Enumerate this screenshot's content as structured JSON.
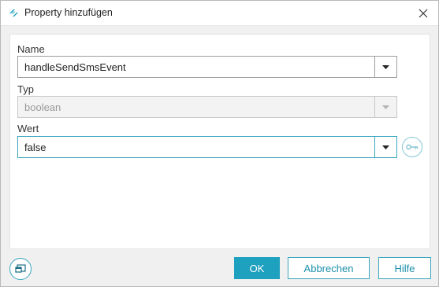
{
  "window": {
    "title": "Property hinzufügen"
  },
  "form": {
    "name": {
      "label": "Name",
      "value": "handleSendSmsEvent"
    },
    "type": {
      "label": "Typ",
      "value": "boolean"
    },
    "value": {
      "label": "Wert",
      "value": "false"
    }
  },
  "buttons": {
    "ok": "OK",
    "cancel": "Abbrechen",
    "help": "Hilfe"
  },
  "colors": {
    "accent": "#1ea0bf",
    "accent_border": "#3aa6bd"
  },
  "icons": {
    "app": "app-logo-icon",
    "close": "close-icon",
    "dropdown": "chevron-down-icon",
    "key": "key-icon",
    "window_toggle": "window-toggle-icon"
  }
}
